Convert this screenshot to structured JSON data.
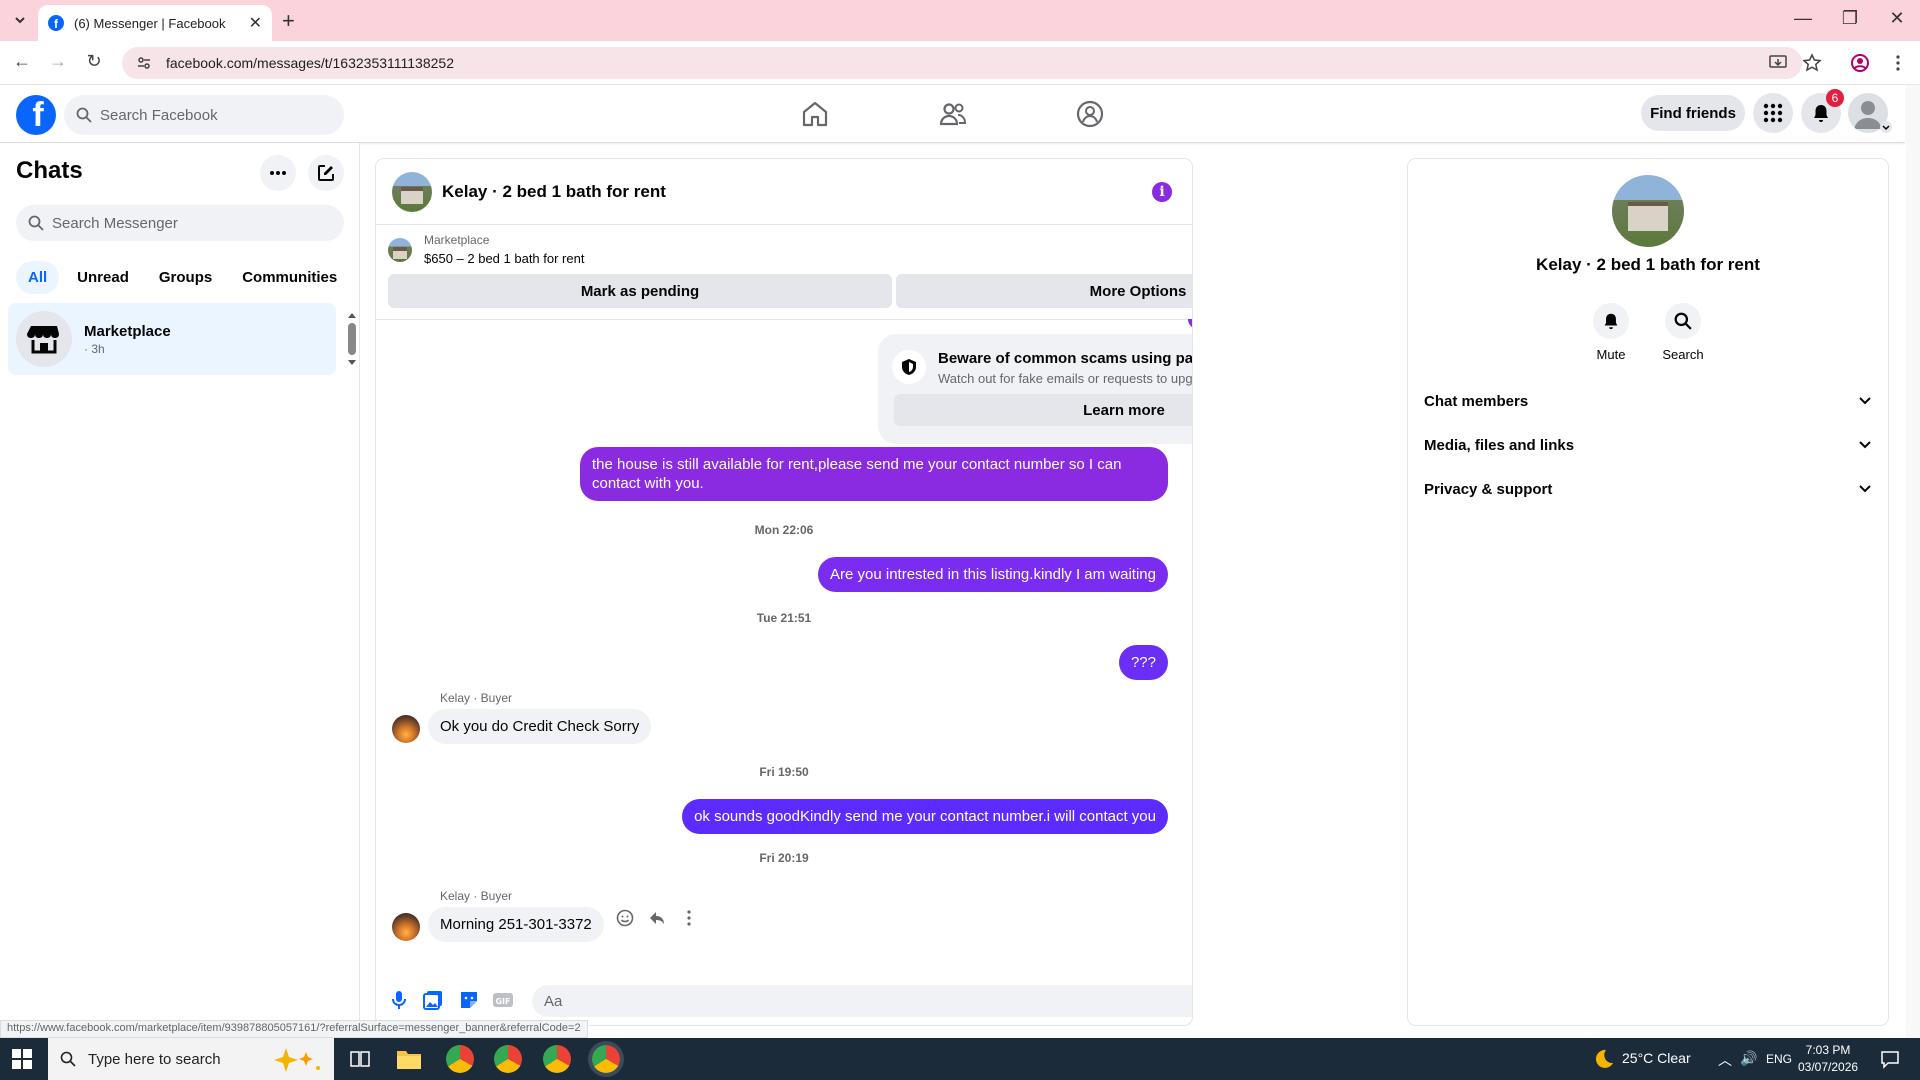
{
  "browser": {
    "tab_title": "(6) Messenger | Facebook",
    "url": "facebook.com/messages/t/1632353111138252",
    "status_url": "https://www.facebook.com/marketplace/item/939878805057161/?referralSurface=messenger_banner&referralCode=2"
  },
  "header": {
    "search_placeholder": "Search Facebook",
    "find_friends": "Find friends",
    "notification_count": "6",
    "brand_color": "#0866ff"
  },
  "sidebar": {
    "title": "Chats",
    "search_placeholder": "Search Messenger",
    "filters": [
      "All",
      "Unread",
      "Groups",
      "Communities"
    ],
    "chats": [
      {
        "name": "Marketplace",
        "time": "· 3h"
      }
    ]
  },
  "conversation": {
    "title": "Kelay · 2 bed 1 bath for rent",
    "banner_label": "Marketplace",
    "banner_price": "$650 – 2 bed 1 bath for rent",
    "mark_pending": "Mark as pending",
    "more_options": "More Options",
    "scam_title": "Beware of common scams using payment apps",
    "scam_sub": "Watch out for fake emails or requests to upgrade your payment account.",
    "learn_more": "Learn more",
    "messages": {
      "m1": "the house is still available for rent,please send me your contact number so I can contact with you.",
      "ts1": "Mon 22:06",
      "m2": "Are you intrested in this listing.kindly I am waiting",
      "ts2": "Tue 21:51",
      "m3": "???",
      "sender1": "Kelay · Buyer",
      "m4": "Ok you do Credit Check Sorry",
      "ts3": "Fri 19:50",
      "m5": "ok sounds goodKindly send me your contact number.i will contact you",
      "ts4": "Fri 20:19",
      "sender2": "Kelay · Buyer",
      "m6": "Morning 251-301-3372"
    },
    "composer_placeholder": "Aa",
    "outgoing_purple": "#8a2be2",
    "outgoing_blue": "#5b2bff"
  },
  "right_panel": {
    "name": "Kelay · 2 bed 1 bath for rent",
    "mute": "Mute",
    "search": "Search",
    "sections": [
      "Chat members",
      "Media, files and links",
      "Privacy & support"
    ]
  },
  "taskbar": {
    "search_placeholder": "Type here to search",
    "weather": "25°C  Clear",
    "lang": "ENG",
    "time": "7:03 PM",
    "date": "03/07/2026"
  }
}
